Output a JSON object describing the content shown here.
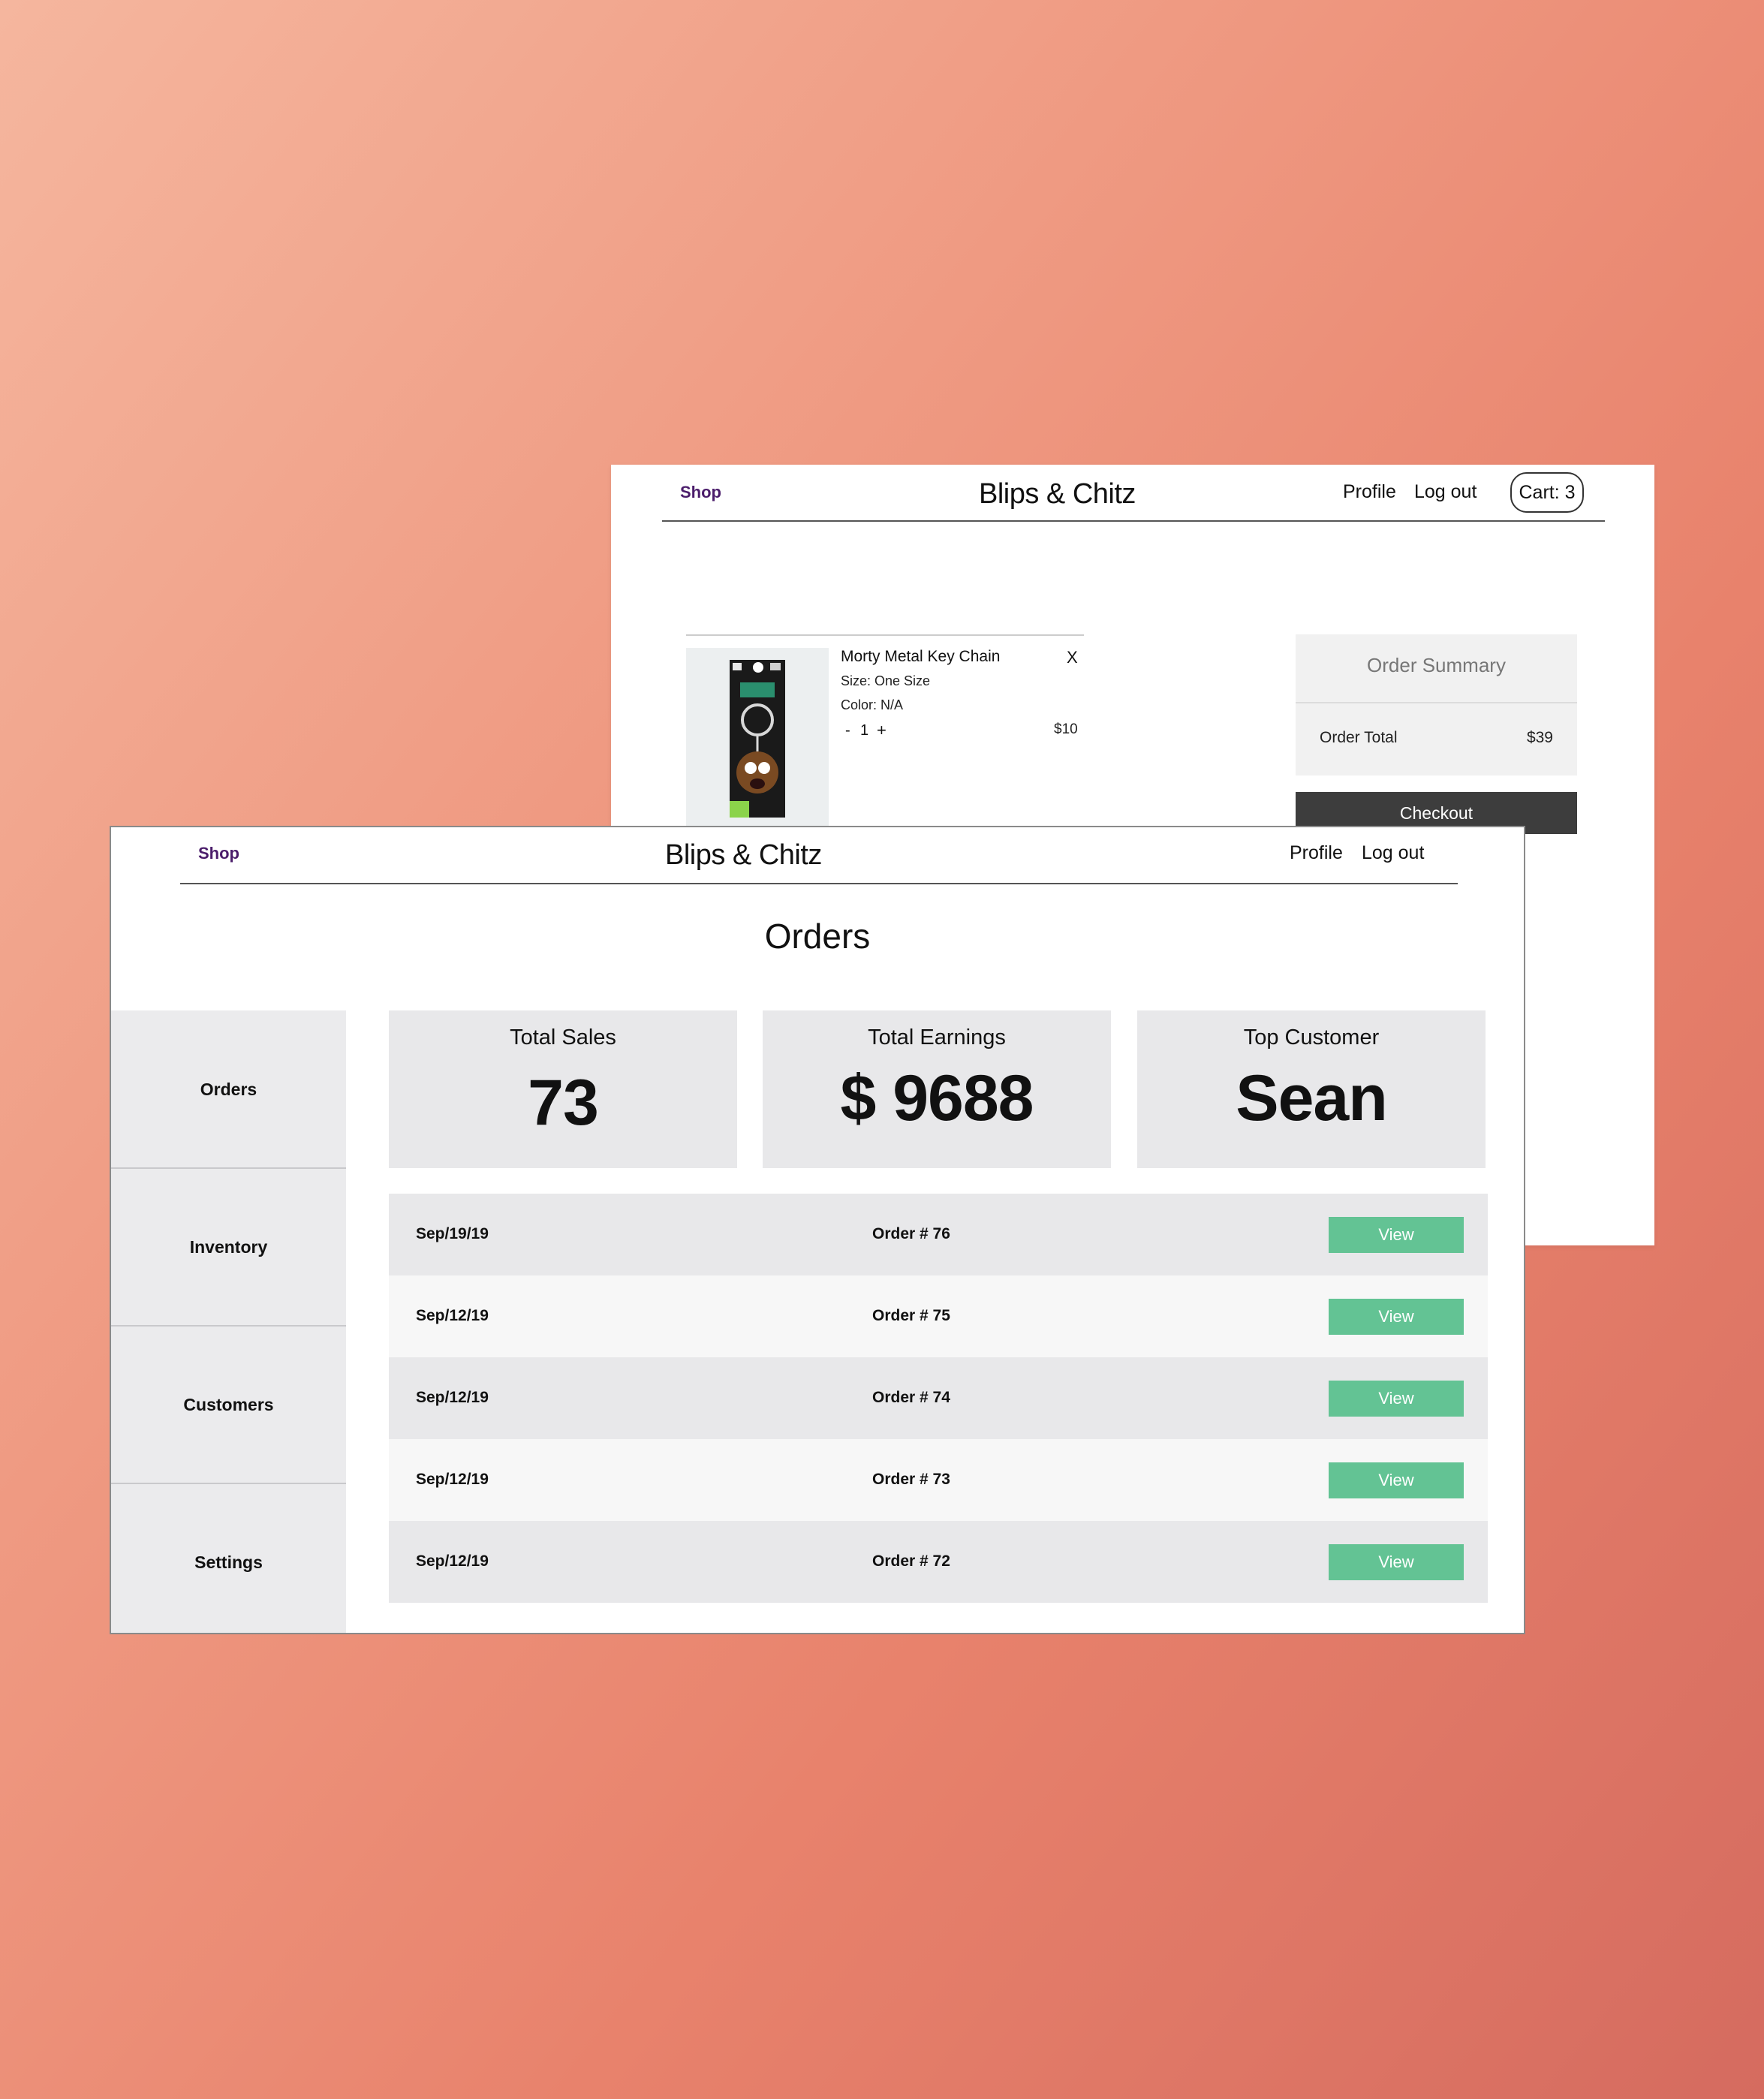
{
  "cart_page": {
    "nav": {
      "shop_label": "Shop",
      "brand": "Blips & Chitz",
      "profile_label": "Profile",
      "logout_label": "Log out",
      "cart_label": "Cart: 3"
    },
    "item": {
      "name": "Morty Metal Key Chain",
      "remove_label": "X",
      "size": "Size: One Size",
      "color": "Color: N/A",
      "qty_minus": "-",
      "qty": "1",
      "qty_plus": "+",
      "price": "$10"
    },
    "summary": {
      "title": "Order Summary",
      "total_label": "Order Total",
      "total_value": "$39",
      "checkout_label": "Checkout"
    }
  },
  "admin_page": {
    "nav": {
      "shop_label": "Shop",
      "brand": "Blips & Chitz",
      "profile_label": "Profile",
      "logout_label": "Log out"
    },
    "title": "Orders",
    "sidebar": {
      "items": [
        {
          "label": "Orders"
        },
        {
          "label": "Inventory"
        },
        {
          "label": "Customers"
        },
        {
          "label": "Settings"
        }
      ]
    },
    "stats": [
      {
        "label": "Total Sales",
        "value": "73"
      },
      {
        "label": "Total Earnings",
        "value": "$ 9688"
      },
      {
        "label": "Top Customer",
        "value": "Sean"
      }
    ],
    "orders": [
      {
        "date": "Sep/19/19",
        "number": "Order # 76",
        "action": "View"
      },
      {
        "date": "Sep/12/19",
        "number": "Order # 75",
        "action": "View"
      },
      {
        "date": "Sep/12/19",
        "number": "Order # 74",
        "action": "View"
      },
      {
        "date": "Sep/12/19",
        "number": "Order # 73",
        "action": "View"
      },
      {
        "date": "Sep/12/19",
        "number": "Order # 72",
        "action": "View"
      }
    ]
  },
  "colors": {
    "shop_link": "#4b1d6b",
    "view_button": "#63c394",
    "checkout_button": "#3d3d3d"
  }
}
